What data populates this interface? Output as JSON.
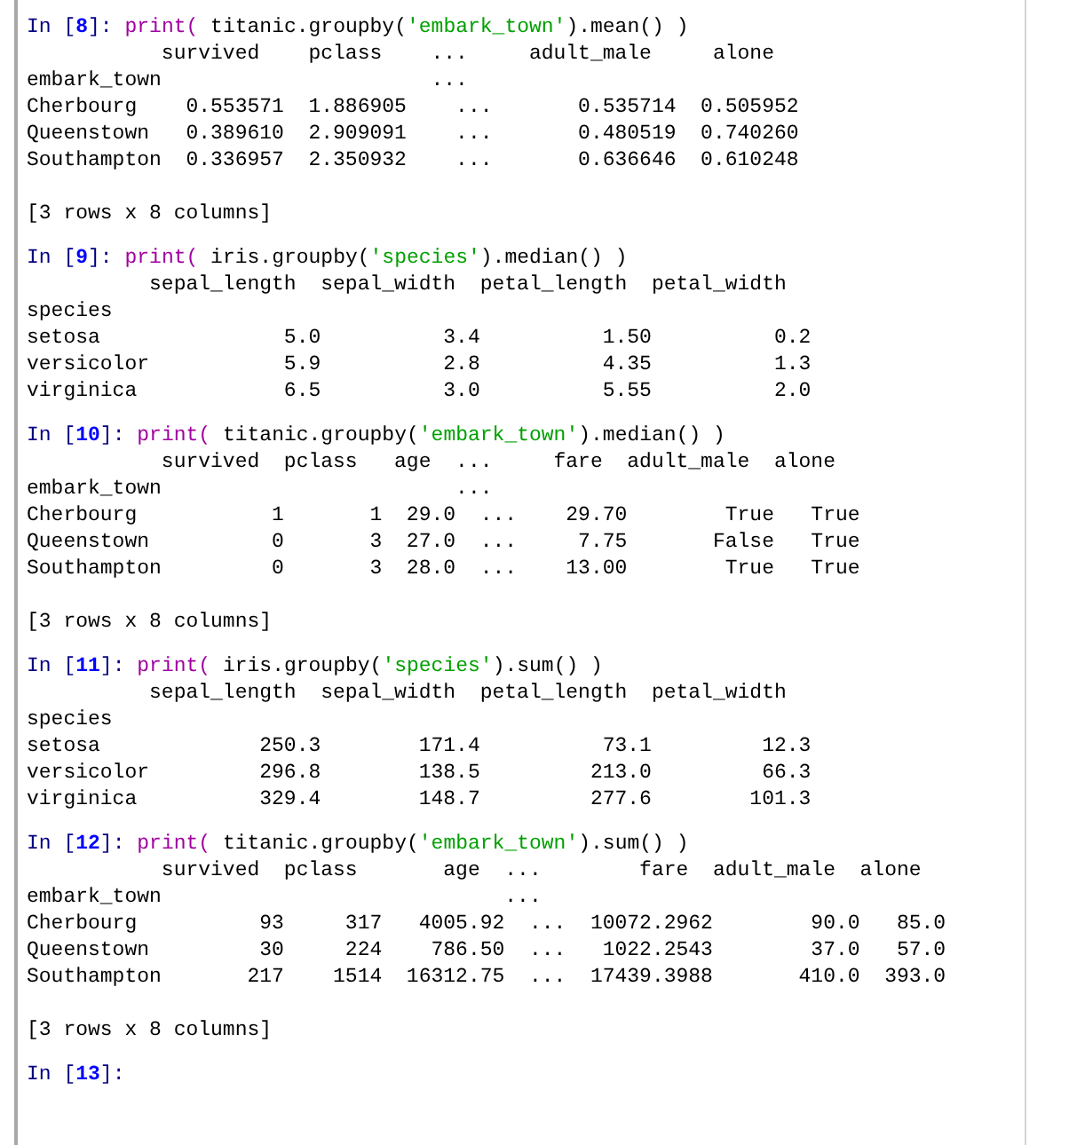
{
  "cells": [
    {
      "prompt": "In [",
      "number": "8",
      "prompt_end": "]: ",
      "code": [
        {
          "kind": "func",
          "text": "print("
        },
        {
          "kind": "plain",
          "text": " titanic.groupby("
        },
        {
          "kind": "string",
          "text": "'embark_town'"
        },
        {
          "kind": "plain",
          "text": ").mean() )"
        }
      ],
      "output": [
        "           survived    pclass    ...     adult_male     alone",
        "embark_town                      ...",
        "Cherbourg    0.553571  1.886905    ...       0.535714  0.505952",
        "Queenstown   0.389610  2.909091    ...       0.480519  0.740260",
        "Southampton  0.336957  2.350932    ...       0.636646  0.610248"
      ],
      "footer": "[3 rows x 8 columns]"
    },
    {
      "prompt": "In [",
      "number": "9",
      "prompt_end": "]: ",
      "code": [
        {
          "kind": "func",
          "text": "print("
        },
        {
          "kind": "plain",
          "text": " iris.groupby("
        },
        {
          "kind": "string",
          "text": "'species'"
        },
        {
          "kind": "plain",
          "text": ").median() )"
        }
      ],
      "output": [
        "          sepal_length  sepal_width  petal_length  petal_width",
        "species",
        "setosa               5.0          3.4          1.50          0.2",
        "versicolor           5.9          2.8          4.35          1.3",
        "virginica            6.5          3.0          5.55          2.0"
      ]
    },
    {
      "prompt": "In [",
      "number": "10",
      "prompt_end": "]: ",
      "code": [
        {
          "kind": "func",
          "text": "print("
        },
        {
          "kind": "plain",
          "text": " titanic.groupby("
        },
        {
          "kind": "string",
          "text": "'embark_town'"
        },
        {
          "kind": "plain",
          "text": ").median() )"
        }
      ],
      "output": [
        "           survived  pclass   age  ...     fare  adult_male  alone",
        "embark_town                        ...",
        "Cherbourg           1       1  29.0  ...    29.70        True   True",
        "Queenstown          0       3  27.0  ...     7.75       False   True",
        "Southampton         0       3  28.0  ...    13.00        True   True"
      ],
      "footer": "[3 rows x 8 columns]"
    },
    {
      "prompt": "In [",
      "number": "11",
      "prompt_end": "]: ",
      "code": [
        {
          "kind": "func",
          "text": "print("
        },
        {
          "kind": "plain",
          "text": " iris.groupby("
        },
        {
          "kind": "string",
          "text": "'species'"
        },
        {
          "kind": "plain",
          "text": ").sum() )"
        }
      ],
      "output": [
        "          sepal_length  sepal_width  petal_length  petal_width",
        "species",
        "setosa             250.3        171.4          73.1         12.3",
        "versicolor         296.8        138.5         213.0         66.3",
        "virginica          329.4        148.7         277.6        101.3"
      ]
    },
    {
      "prompt": "In [",
      "number": "12",
      "prompt_end": "]: ",
      "code": [
        {
          "kind": "func",
          "text": "print("
        },
        {
          "kind": "plain",
          "text": " titanic.groupby("
        },
        {
          "kind": "string",
          "text": "'embark_town'"
        },
        {
          "kind": "plain",
          "text": ").sum() )"
        }
      ],
      "output": [
        "           survived  pclass       age  ...        fare  adult_male  alone",
        "embark_town                            ...",
        "Cherbourg          93     317   4005.92  ...  10072.2962        90.0   85.0",
        "Queenstown         30     224    786.50  ...   1022.2543        37.0   57.0",
        "Southampton       217    1514  16312.75  ...  17439.3988       410.0  393.0"
      ],
      "footer": "[3 rows x 8 columns]"
    },
    {
      "prompt": "In [",
      "number": "13",
      "prompt_end": "]:"
    }
  ]
}
